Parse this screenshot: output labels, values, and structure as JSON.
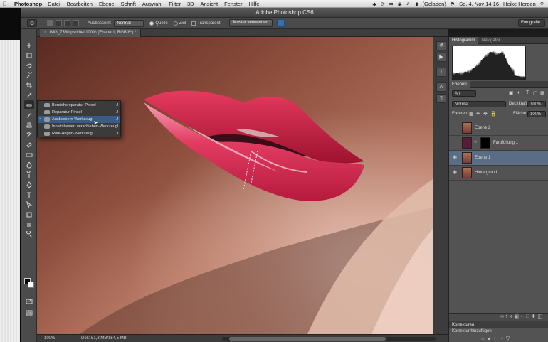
{
  "menubar": {
    "app": "Photoshop",
    "items": [
      "Datei",
      "Bearbeiten",
      "Ebene",
      "Schrift",
      "Auswahl",
      "Filter",
      "3D",
      "Ansicht",
      "Fenster",
      "Hilfe"
    ],
    "battery": "(Geladen)",
    "datetime": "So. 4. Nov  14:16",
    "user": "Heike Herden"
  },
  "window": {
    "title": "Adobe Photoshop CS6"
  },
  "options": {
    "mode_label": "Ausbessern:",
    "mode_value": "Normal",
    "source_label": "Quelle",
    "target_label": "Ziel",
    "transparent_label": "Transparent",
    "pattern_button": "Muster verwenden",
    "workspace": "Fotografie"
  },
  "document": {
    "tab_title": "IMG_7380.psd bei 100% (Ebene 1, RGB/8*) *",
    "zoom": "100%",
    "doc_info": "Dok: 51,3 MB/154,5 MB"
  },
  "flyout": [
    {
      "label": "Bereichsreparatur-Pinsel",
      "key": "J",
      "selected": false
    },
    {
      "label": "Reparatur-Pinsel",
      "key": "J",
      "selected": false
    },
    {
      "label": "Ausbessern-Werkzeug",
      "key": "J",
      "selected": true
    },
    {
      "label": "Inhaltsbasiert verschieben-Werkzeug",
      "key": "J",
      "selected": false
    },
    {
      "label": "Rote-Augen-Werkzeug",
      "key": "J",
      "selected": false
    }
  ],
  "histogram_panel": {
    "tabs": [
      "Histogramm",
      "Navigator"
    ]
  },
  "layers_panel": {
    "tab": "Ebenen",
    "filter": "Art",
    "blend_mode": "Normal",
    "opacity_label": "Deckkraft:",
    "opacity_value": "100%",
    "lock_label": "Fixieren:",
    "fill_label": "Fläche:",
    "fill_value": "100%",
    "layers": [
      {
        "name": "Ebene 2",
        "visible": false,
        "selected": false,
        "type": "pixel"
      },
      {
        "name": "Farbfüllung 1",
        "visible": false,
        "selected": false,
        "type": "fill"
      },
      {
        "name": "Ebene 1",
        "visible": true,
        "selected": true,
        "type": "pixel"
      },
      {
        "name": "Hintergrund",
        "visible": true,
        "selected": false,
        "type": "pixel"
      }
    ]
  },
  "corrections_panel": {
    "title": "Korrekturen",
    "subtitle": "Korrektur hinzufügen"
  },
  "colors": {
    "ui_dark": "#4b4b4b",
    "selection_blue": "#3a5a8a",
    "lip_red": "#d0294c",
    "skin": "#c98b74"
  }
}
